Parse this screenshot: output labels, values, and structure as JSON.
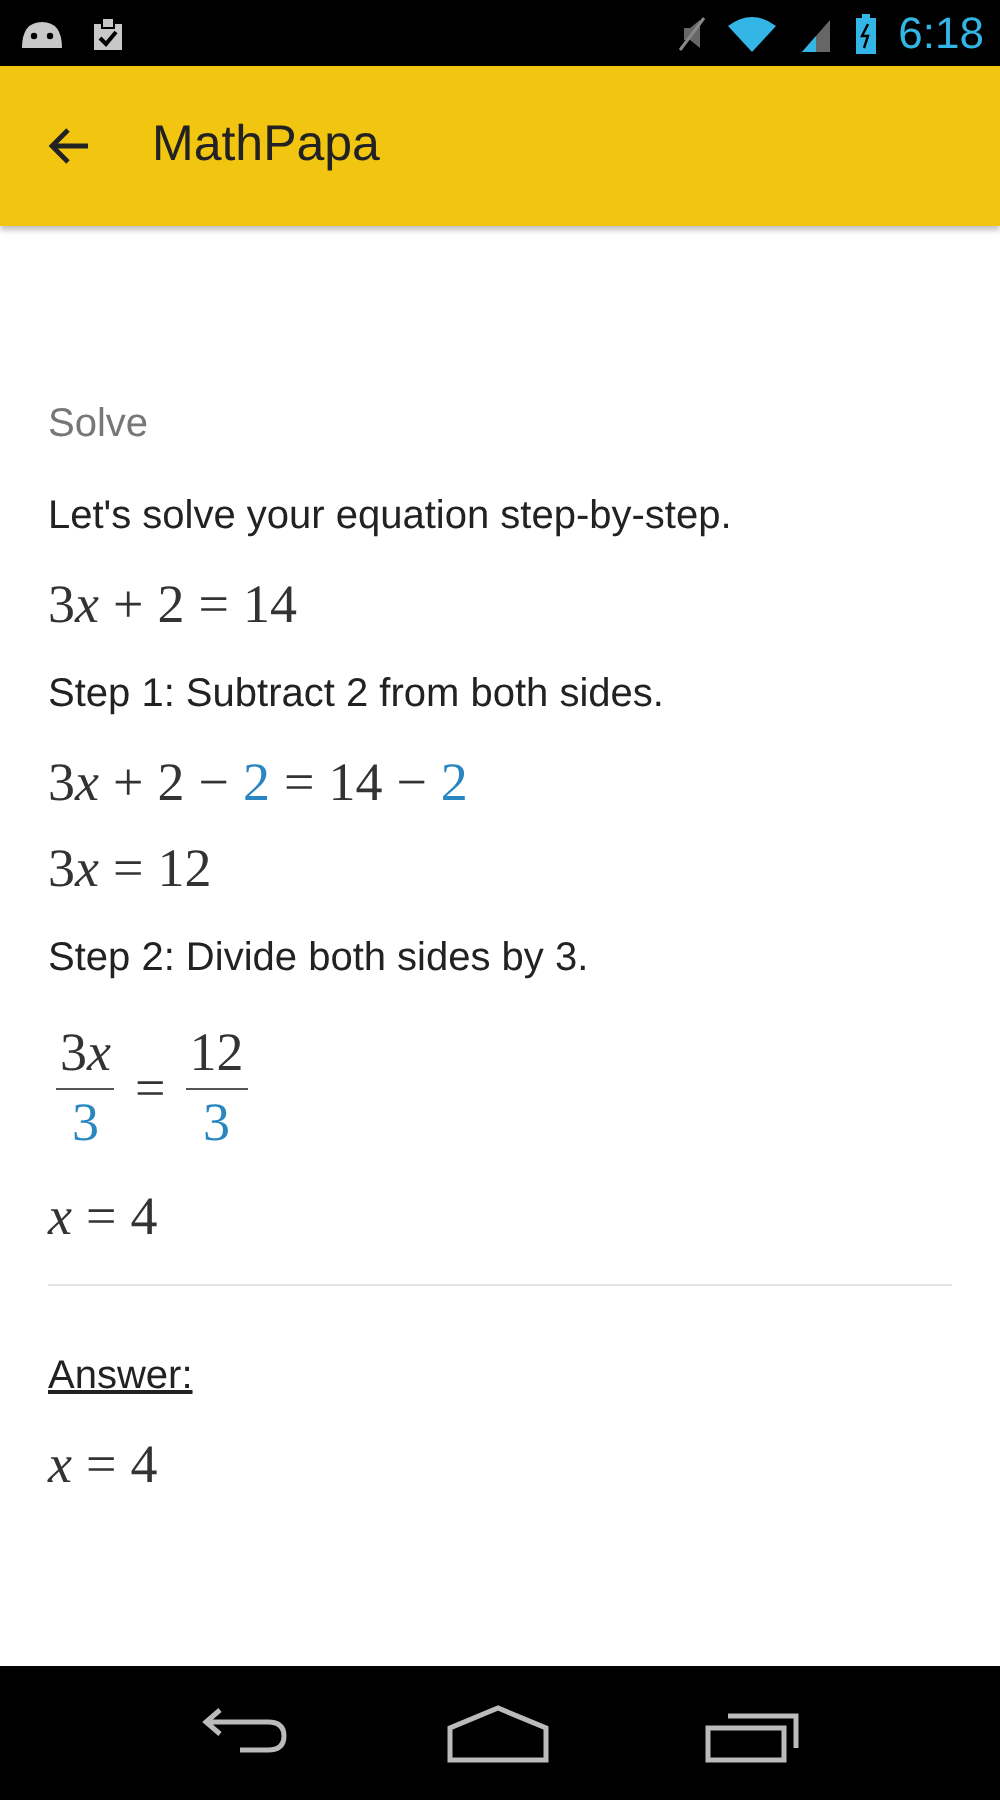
{
  "status_bar": {
    "time": "6:18"
  },
  "app_bar": {
    "title": "MathPapa"
  },
  "content": [
    {
      "kind": "heading",
      "text": "Solve"
    },
    {
      "kind": "text",
      "text": "Let's solve your equation step-by-step."
    },
    {
      "kind": "math",
      "tokens": [
        {
          "text": "3",
          "italic": false,
          "highlight": false
        },
        {
          "text": "x",
          "italic": true,
          "highlight": false
        },
        {
          "text": "+",
          "italic": false,
          "highlight": false
        },
        {
          "text": "2",
          "italic": false,
          "highlight": false
        },
        {
          "text": "=",
          "italic": false,
          "highlight": false
        },
        {
          "text": "14",
          "italic": false,
          "highlight": false
        }
      ]
    },
    {
      "kind": "text",
      "text": "Step 1: Subtract 2 from both sides."
    },
    {
      "kind": "math",
      "tokens": [
        {
          "text": "3",
          "italic": false,
          "highlight": false
        },
        {
          "text": "x",
          "italic": true,
          "highlight": false
        },
        {
          "text": "+",
          "italic": false,
          "highlight": false
        },
        {
          "text": "2",
          "italic": false,
          "highlight": false
        },
        {
          "text": "−",
          "italic": false,
          "highlight": false
        },
        {
          "text": "2",
          "italic": false,
          "highlight": true
        },
        {
          "text": "=",
          "italic": false,
          "highlight": false
        },
        {
          "text": "14",
          "italic": false,
          "highlight": false
        },
        {
          "text": "−",
          "italic": false,
          "highlight": false
        },
        {
          "text": "2",
          "italic": false,
          "highlight": true
        }
      ]
    },
    {
      "kind": "math",
      "tokens": [
        {
          "text": "3",
          "italic": false,
          "highlight": false
        },
        {
          "text": "x",
          "italic": true,
          "highlight": false
        },
        {
          "text": "=",
          "italic": false,
          "highlight": false
        },
        {
          "text": "12",
          "italic": false,
          "highlight": false
        }
      ]
    },
    {
      "kind": "text",
      "text": "Step 2: Divide both sides by 3."
    },
    {
      "kind": "fraction_equation",
      "left": {
        "numerator": [
          {
            "text": "3",
            "italic": false
          },
          {
            "text": "x",
            "italic": true
          }
        ],
        "denominator": "3"
      },
      "operator": "=",
      "right": {
        "numerator": [
          {
            "text": "12",
            "italic": false
          }
        ],
        "denominator": "3"
      }
    },
    {
      "kind": "math",
      "tokens": [
        {
          "text": "x",
          "italic": true,
          "highlight": false
        },
        {
          "text": "=",
          "italic": false,
          "highlight": false
        },
        {
          "text": "4",
          "italic": false,
          "highlight": false
        }
      ]
    },
    {
      "kind": "divider"
    },
    {
      "kind": "answer_label",
      "text": "Answer:"
    },
    {
      "kind": "math",
      "tokens": [
        {
          "text": "x",
          "italic": true,
          "highlight": false
        },
        {
          "text": "=",
          "italic": false,
          "highlight": false
        },
        {
          "text": "4",
          "italic": false,
          "highlight": false
        }
      ]
    }
  ]
}
